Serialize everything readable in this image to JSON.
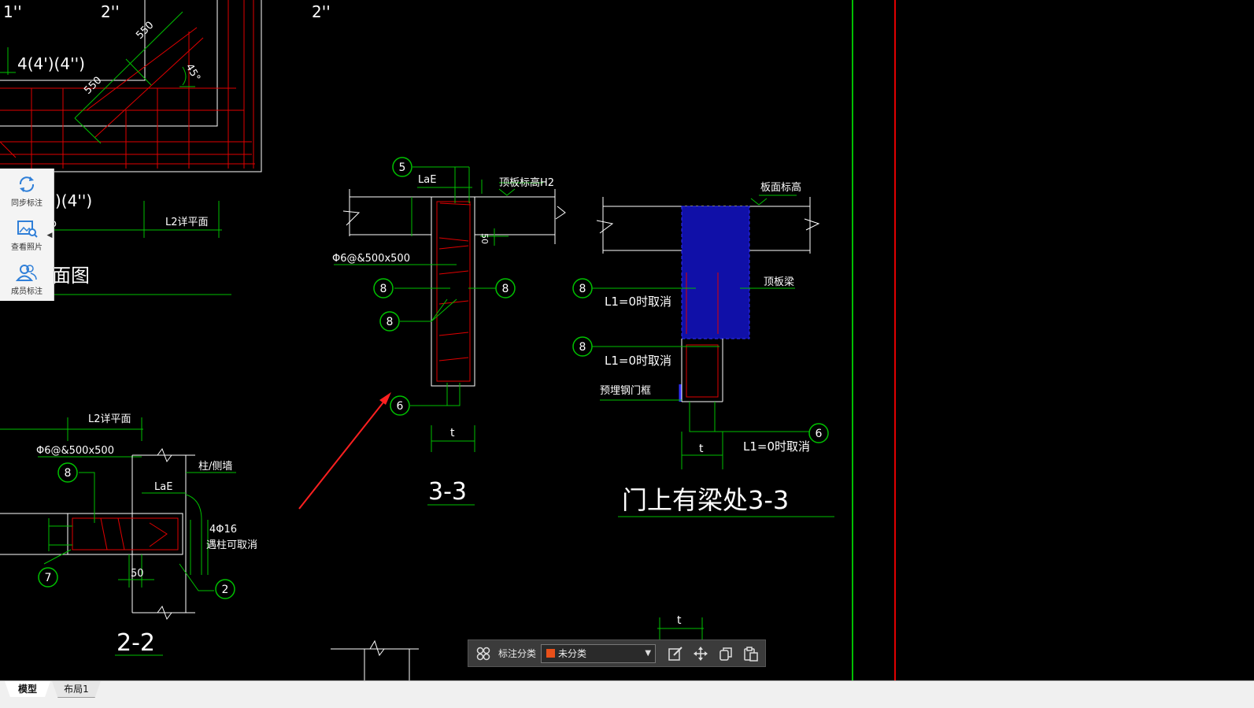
{
  "side_toolbar": {
    "items": [
      {
        "label": "同步标注",
        "icon": "sync-icon"
      },
      {
        "label": "查看照片",
        "icon": "photo-view-icon"
      },
      {
        "label": "成员标注",
        "icon": "members-icon"
      }
    ]
  },
  "annotation_bar": {
    "category_label": "标注分类",
    "category_value": "未分类",
    "category_color": "#e8501a"
  },
  "layout_tabs": {
    "model": "模型",
    "layout1": "布局1"
  },
  "drawing": {
    "top_left_marks": [
      "1''",
      "2''",
      "2''"
    ],
    "rebar_note_top": "4(4')(4'')",
    "rebar_note_mid": ")(4'')",
    "dim_550_a": "550",
    "dim_550_b": "550",
    "angle_45": "45°",
    "plan_title_tail": "面图",
    "l2_detail_1": "L2详平面",
    "l2_detail_2": "L2详平面",
    "lae_1": "LaE",
    "lae_2": "LaE",
    "slab_top_elev_h2": "顶板标高H2",
    "slab_top_elev": "板面标高",
    "stirrup_note_1": "Φ6@&500x500",
    "stirrup_note_2": "Φ6@&500x500",
    "dim_50_a": "50",
    "dim_50_b": "50",
    "top_slab_beam": "顶板梁",
    "l1_cancel_1": "L1=0时取消",
    "l1_cancel_2": "L1=0时取消",
    "l1_cancel_3": "L1=0时取消",
    "embedded_frame": "预埋钢门框",
    "dim_t_1": "t",
    "dim_t_2": "t",
    "dim_t_3": "t",
    "section_33": "3-3",
    "section_33_beam": "门上有梁处3-3",
    "section_22": "2-2",
    "column_wall": "柱/侧墙",
    "rebar_4_16": "4Φ16",
    "when_column_cancel": "遇柱可取消",
    "small_o": "o",
    "callouts": [
      "5",
      "8",
      "8",
      "8",
      "6",
      "8",
      "8",
      "6",
      "8",
      "7",
      "2"
    ]
  }
}
